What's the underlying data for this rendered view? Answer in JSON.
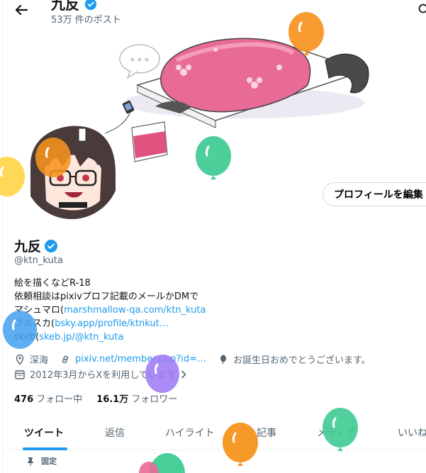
{
  "header": {
    "title": "九反",
    "post_count": "53万 件のポスト"
  },
  "profile": {
    "name": "九反",
    "handle": "@ktn_kuta",
    "edit_label": "プロフィールを編集",
    "bio_line1": "絵を描くなどR-18",
    "bio_line2": "依頼相談はpixivプロフ記載のメールかDMで",
    "bio_line3_prefix": "マシュマロ(",
    "bio_line3_link": "marshmallow-qa.com/ktn_kuta",
    "bio_line4_prefix": "ブルスカ(",
    "bio_line4_link": "bsky.app/profile/ktnkut…",
    "bio_line5_prefix": "skeb(",
    "bio_line5_link": "skeb.jp/@ktn_kuta",
    "location": "深海",
    "website": "pixiv.net/member.php?id=…",
    "birthday": "お誕生日おめでとうございます。",
    "joined": "2012年3月からXを利用しています",
    "following_count": "476",
    "following_label": "フォロー中",
    "followers_count": "16.1万",
    "followers_label": "フォロワー"
  },
  "tabs": [
    "ツイート",
    "返信",
    "ハイライト",
    "記事",
    "メディア",
    "いいね"
  ],
  "pinned_label": "固定",
  "colors": {
    "accent": "#1d9bf0",
    "balloon_orange": "#f7931e",
    "balloon_green": "#3ecb94",
    "balloon_blue": "#4aa3f0",
    "balloon_purple": "#9f7bf5",
    "balloon_yellow": "#ffd54a"
  },
  "icons": [
    "back-arrow-icon",
    "search-icon",
    "verified-icon",
    "location-icon",
    "link-icon",
    "balloon-icon",
    "calendar-icon",
    "chevron-right-icon",
    "pin-icon"
  ]
}
